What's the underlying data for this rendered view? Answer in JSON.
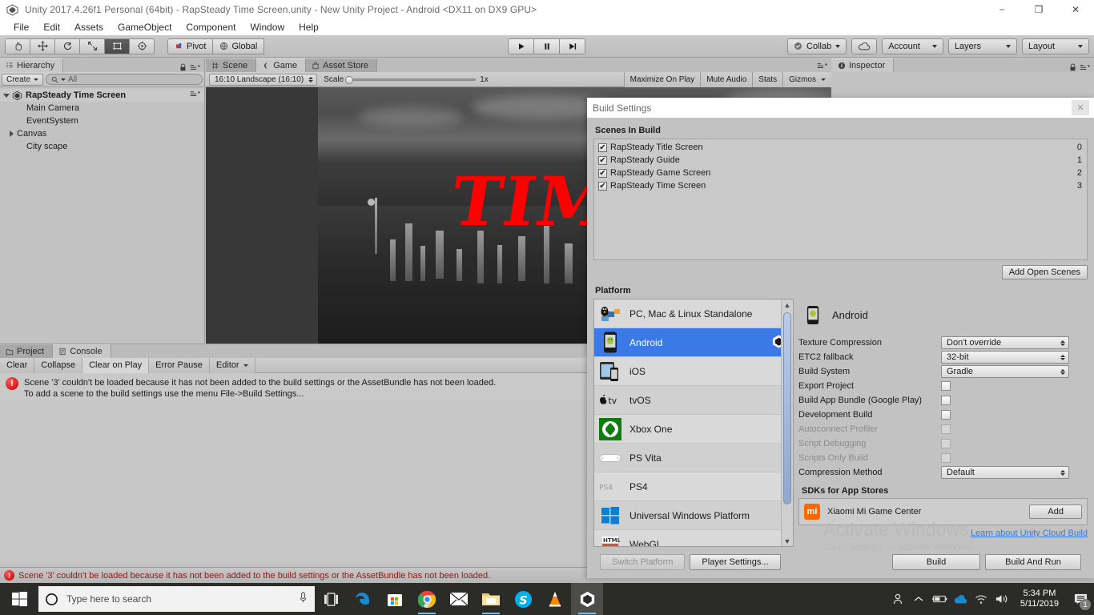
{
  "window": {
    "title": "Unity 2017.4.26f1 Personal (64bit) - RapSteady Time Screen.unity - New Unity Project - Android <DX11 on DX9 GPU>",
    "minimize": "−",
    "maximize": "❐",
    "close": "✕"
  },
  "menubar": {
    "items": [
      "File",
      "Edit",
      "Assets",
      "GameObject",
      "Component",
      "Window",
      "Help"
    ]
  },
  "toolbar": {
    "pivot_label": "Pivot",
    "global_label": "Global",
    "collab_label": "Collab",
    "account_label": "Account",
    "layers_label": "Layers",
    "layout_label": "Layout"
  },
  "hierarchy": {
    "tab_label": "Hierarchy",
    "create_label": "Create",
    "search_placeholder": "All",
    "root": "RapSteady Time Screen",
    "items": [
      {
        "label": "Main Camera",
        "expandable": false
      },
      {
        "label": "EventSystem",
        "expandable": false
      },
      {
        "label": "Canvas",
        "expandable": true
      },
      {
        "label": "City scape",
        "expandable": false
      }
    ]
  },
  "gameview": {
    "tabs": [
      "Scene",
      "Game",
      "Asset Store"
    ],
    "active_tab": "Game",
    "aspect": "16:10 Landscape (16:10)",
    "scale_label": "Scale",
    "scale_value": "1x",
    "buttons": [
      "Maximize On Play",
      "Mute Audio",
      "Stats",
      "Gizmos"
    ],
    "overlay_text": "TIME"
  },
  "inspector": {
    "tab_label": "Inspector"
  },
  "console": {
    "tabs": [
      "Project",
      "Console"
    ],
    "active_tab": "Console",
    "buttons": [
      "Clear",
      "Collapse",
      "Clear on Play",
      "Error Pause",
      "Editor"
    ],
    "log_line1": "Scene '3' couldn't be loaded because it has not been added to the build settings or the AssetBundle has not been loaded.",
    "log_line2": "To add a scene to the build settings use the menu File->Build Settings..."
  },
  "statusbar": {
    "message": "Scene '3' couldn't be loaded because it has not been added to the build settings or the AssetBundle has not been loaded."
  },
  "build_settings": {
    "title": "Build Settings",
    "scenes_header": "Scenes In Build",
    "scenes": [
      {
        "name": "RapSteady Title Screen",
        "index": "0",
        "checked": true
      },
      {
        "name": "RapSteady Guide",
        "index": "1",
        "checked": true
      },
      {
        "name": "RapSteady Game Screen",
        "index": "2",
        "checked": true
      },
      {
        "name": "RapSteady Time Screen",
        "index": "3",
        "checked": true
      }
    ],
    "add_open_scenes": "Add Open Scenes",
    "platform_header": "Platform",
    "platforms": [
      {
        "label": "PC, Mac & Linux Standalone",
        "icon": "standalone-icon",
        "selected": false
      },
      {
        "label": "Android",
        "icon": "android-icon",
        "selected": true
      },
      {
        "label": "iOS",
        "icon": "ios-icon",
        "selected": false
      },
      {
        "label": "tvOS",
        "icon": "tvos-icon",
        "selected": false
      },
      {
        "label": "Xbox One",
        "icon": "xbox-icon",
        "selected": false
      },
      {
        "label": "PS Vita",
        "icon": "psvita-icon",
        "selected": false
      },
      {
        "label": "PS4",
        "icon": "ps4-icon",
        "selected": false
      },
      {
        "label": "Universal Windows Platform",
        "icon": "windows-icon",
        "selected": false
      },
      {
        "label": "WebGL",
        "icon": "html5-icon",
        "selected": false
      }
    ],
    "detail_title": "Android",
    "settings": [
      {
        "label": "Texture Compression",
        "type": "dropdown",
        "value": "Don't override",
        "disabled": false
      },
      {
        "label": "ETC2 fallback",
        "type": "dropdown",
        "value": "32-bit",
        "disabled": false
      },
      {
        "label": "Build System",
        "type": "dropdown",
        "value": "Gradle",
        "disabled": false
      },
      {
        "label": "Export Project",
        "type": "checkbox",
        "value": false,
        "disabled": false
      },
      {
        "label": "Build App Bundle (Google Play)",
        "type": "checkbox",
        "value": false,
        "disabled": false
      },
      {
        "label": "Development Build",
        "type": "checkbox",
        "value": false,
        "disabled": false
      },
      {
        "label": "Autoconnect Profiler",
        "type": "checkbox",
        "value": false,
        "disabled": true
      },
      {
        "label": "Script Debugging",
        "type": "checkbox",
        "value": false,
        "disabled": true
      },
      {
        "label": "Scripts Only Build",
        "type": "checkbox",
        "value": false,
        "disabled": true
      },
      {
        "label": "Compression Method",
        "type": "dropdown",
        "value": "Default",
        "disabled": false
      }
    ],
    "sdk_header": "SDKs for App Stores",
    "sdk_name": "Xiaomi Mi Game Center",
    "sdk_add_label": "Add",
    "cloud_build_link": "Learn about Unity Cloud Build",
    "switch_platform": "Switch Platform",
    "player_settings": "Player Settings...",
    "build": "Build",
    "build_and_run": "Build And Run"
  },
  "watermark": {
    "line1": "Activate Windows",
    "line2": "Go to Settings to activate Windows."
  },
  "taskbar": {
    "search_placeholder": "Type here to search",
    "apps": [
      "task-view",
      "edge",
      "store",
      "chrome",
      "mail",
      "explorer",
      "skype",
      "vlc",
      "unity"
    ],
    "time": "5:34 PM",
    "date": "5/11/2019",
    "notification_count": "1"
  }
}
